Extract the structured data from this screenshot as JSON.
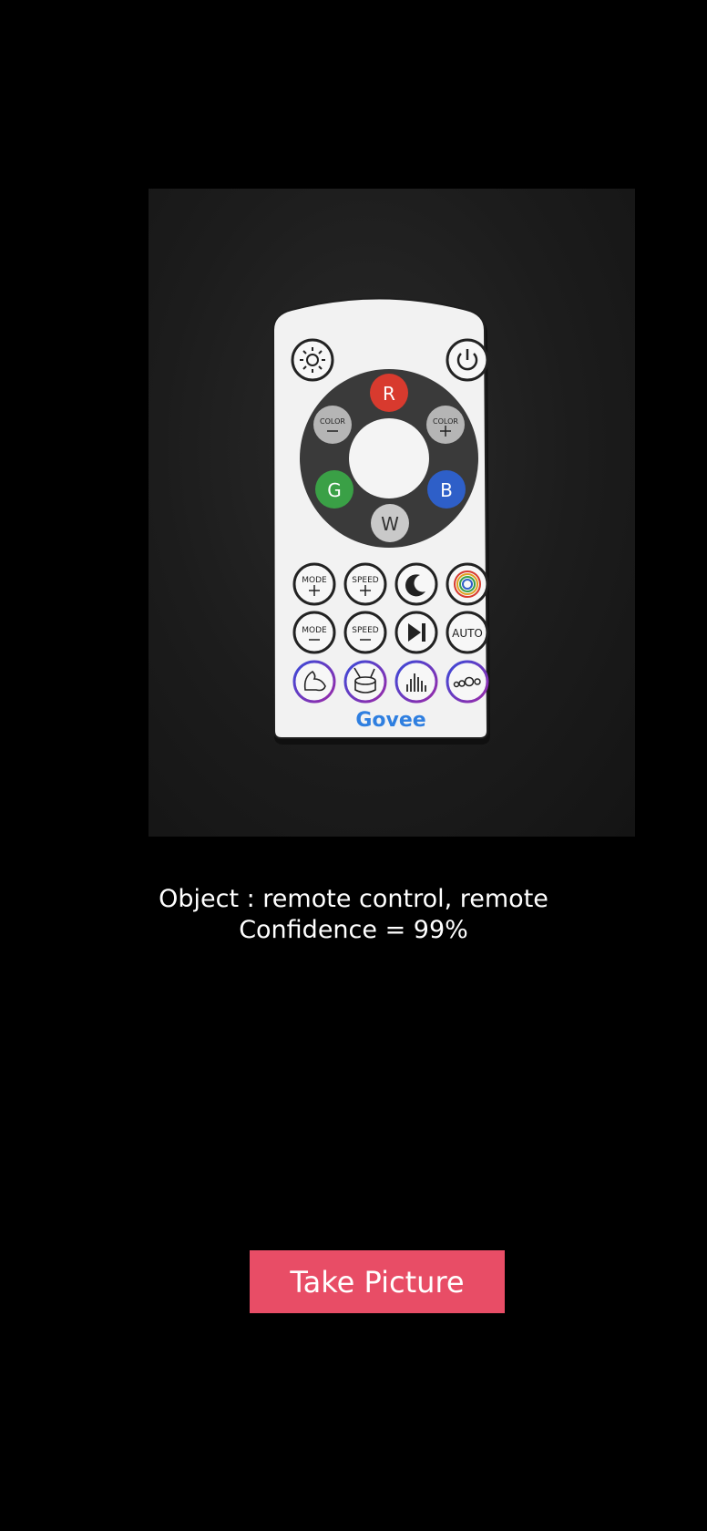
{
  "photo": {
    "remote": {
      "labels": {
        "red": "R",
        "green": "G",
        "blue": "B",
        "white": "W",
        "color_minus": "COLOR",
        "color_plus": "COLOR",
        "mode_plus": "MODE",
        "speed_plus": "SPEED",
        "mode_minus": "MODE",
        "speed_minus": "SPEED",
        "auto": "AUTO",
        "brand": "Govee"
      },
      "colors": {
        "red": "#d83a2e",
        "green": "#3aa046",
        "blue": "#2e5fc8",
        "white_button": "#c9c9c9",
        "grey_button": "#b5b5b5",
        "ring": "#3a3a3a",
        "body": "#f2f2f2",
        "brand": "#2f7fe0"
      }
    }
  },
  "result": {
    "object_line": "Object : remote control, remote",
    "confidence_line": "Confidence = 99%"
  },
  "actions": {
    "take_picture_label": "Take Picture",
    "button_color": "#e84d66"
  }
}
